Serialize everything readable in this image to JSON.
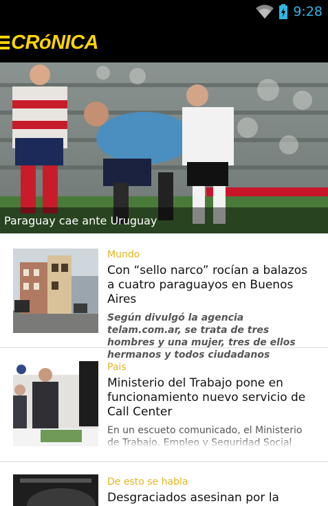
{
  "status_bar": {
    "time": "9:28",
    "wifi_icon": "wifi-icon",
    "battery_icon": "battery-charging-icon"
  },
  "app": {
    "logo": "CRóNICA",
    "menu_icon": "hamburger-menu-icon",
    "accent_color": "#ffd500"
  },
  "hero": {
    "caption": "Paraguay cae ante Uruguay"
  },
  "articles": [
    {
      "section": "Mundo",
      "headline": "Con “sello narco” rocían a balazos a cuatro paraguayos en Buenos Aires",
      "summary": "Según divulgó la agencia telam.com.ar, se trata de tres hombres y una mujer, tres de ellos hermanos y todos ciudadanos"
    },
    {
      "section": "Pais",
      "headline": "Ministerio del Trabajo pone en funcionamiento nuevo servicio de Call Center",
      "summary": "En un escueto comunicado, el Ministerio de Trabajo, Empleo y Seguridad Social"
    },
    {
      "section": "De esto se habla",
      "headline": "Desgraciados asesinan por la espalda",
      "summary": ""
    }
  ]
}
